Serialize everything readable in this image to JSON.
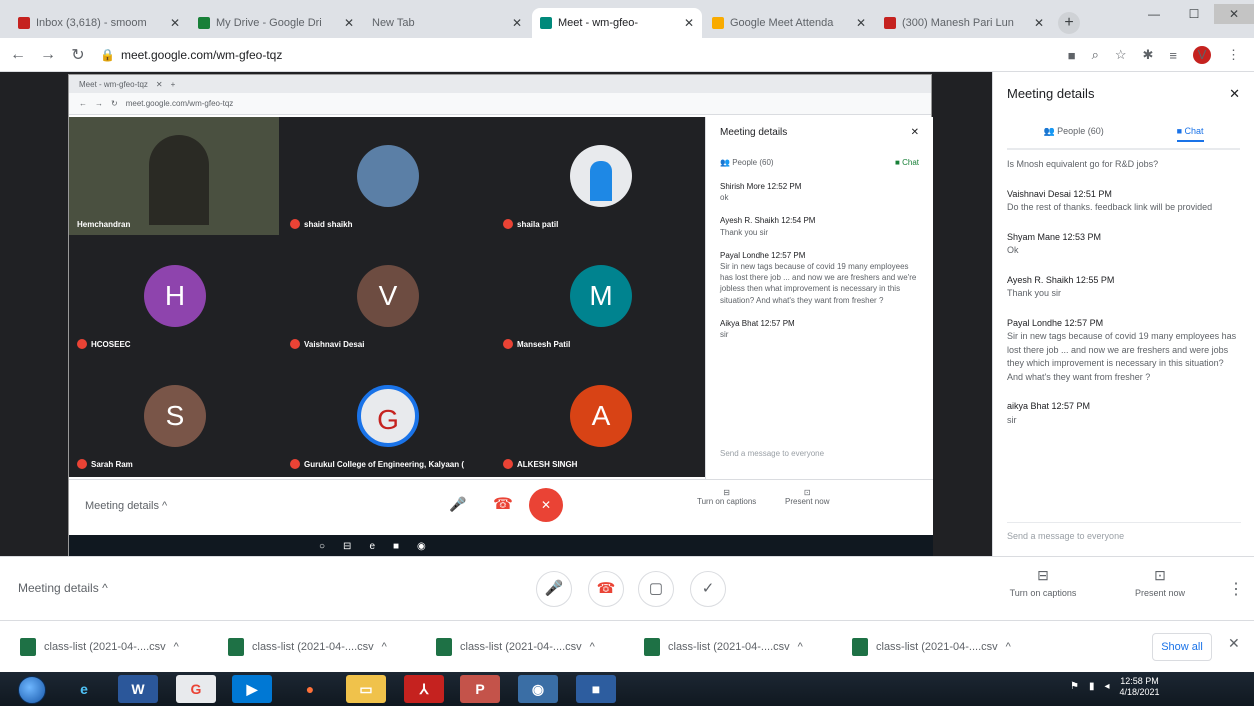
{
  "browser": {
    "tabs": [
      {
        "label": "Inbox (3,618) - smoom",
        "color": "#c5221f"
      },
      {
        "label": "My Drive - Google Dri",
        "color": "#188038"
      },
      {
        "label": "New Tab",
        "color": "#9aa0a6"
      },
      {
        "label": "Meet - wm-gfeo-",
        "color": "#00897b"
      },
      {
        "label": "Google Meet Attenda",
        "color": "#f9ab00"
      },
      {
        "label": "(300) Manesh Pari Lun",
        "color": "#c5221f"
      }
    ],
    "url": "meet.google.com/wm-gfeo-tqz",
    "profile_initial": "V"
  },
  "inner_window": {
    "tab_label": "Meet - wm-gfeo-tqz",
    "url": "meet.google.com/wm-gfeo-tqz",
    "participants": [
      {
        "name": "Hemchandran",
        "initial": "",
        "color": "#4a5040"
      },
      {
        "name": "shaid shaikh",
        "initial": "",
        "color": "#5b7fa6"
      },
      {
        "name": "shaila patil",
        "initial": "",
        "color": "#e8eaed"
      },
      {
        "name": "HCOSEEC",
        "initial": "H",
        "color": "#8e44ad"
      },
      {
        "name": "Vaishnavi Desai",
        "initial": "V",
        "color": "#6d4c41"
      },
      {
        "name": "Mansesh Patil",
        "initial": "M",
        "color": "#00838f"
      },
      {
        "name": "Sarah Ram",
        "initial": "S",
        "color": "#795548"
      },
      {
        "name": "Gurukul College of Engineering, Kalyaan (",
        "initial": "G",
        "color": "#e8eaed"
      },
      {
        "name": "ALKESH SINGH",
        "initial": "A",
        "color": "#d84315"
      }
    ],
    "panel_title": "Meeting details",
    "people_tab": "People (60)",
    "chat_tab": "Chat",
    "messages": [
      {
        "who": "Shirish More 12:52 PM",
        "text": "ok"
      },
      {
        "who": "Ayesh R. Shaikh 12:54 PM",
        "text": "Thank you sir"
      },
      {
        "who": "Payal Londhe 12:57 PM",
        "text": "Sir in new tags because of covid 19 many employees has lost there job ... and now we are freshers and we're jobless then what improvement is necessary in this situation? And what's they want from fresher ?"
      },
      {
        "who": "Aikya Bhat 12:57 PM",
        "text": "sir"
      }
    ],
    "send_placeholder": "Send a message to everyone",
    "meeting_details_label": "Meeting details",
    "turn_on_captions": "Turn on captions",
    "present_now": "Present now"
  },
  "right_panel": {
    "title": "Meeting details",
    "people_tab": "People (60)",
    "chat_tab": "Chat",
    "messages": [
      {
        "who": "",
        "text": "Is Mnosh equivalent go for R&D jobs?"
      },
      {
        "who": "Vaishnavi Desai 12:51 PM",
        "text": "Do the rest of thanks. feedback link will be provided"
      },
      {
        "who": "Shyam Mane 12:53 PM",
        "text": "Ok"
      },
      {
        "who": "Ayesh R. Shaikh 12:55 PM",
        "text": "Thank you sir"
      },
      {
        "who": "Payal Londhe 12:57 PM",
        "text": "Sir in new tags because of covid 19 many employees has lost there job ... and now we are freshers and were jobs they which improvement is necessary in this situation? And what's they want from fresher ?"
      },
      {
        "who": "aikya Bhat 12:57 PM",
        "text": "sir"
      }
    ],
    "send_placeholder": "Send a message to everyone"
  },
  "controls": {
    "meeting_details": "Meeting details",
    "turn_on_captions": "Turn on captions",
    "present_now": "Present now"
  },
  "downloads": [
    "class-list (2021-04-....csv",
    "class-list (2021-04-....csv",
    "class-list (2021-04-....csv",
    "class-list (2021-04-....csv",
    "class-list (2021-04-....csv"
  ],
  "show_all": "Show all",
  "taskbar": {
    "time": "12:58 PM",
    "date": "4/18/2021"
  }
}
